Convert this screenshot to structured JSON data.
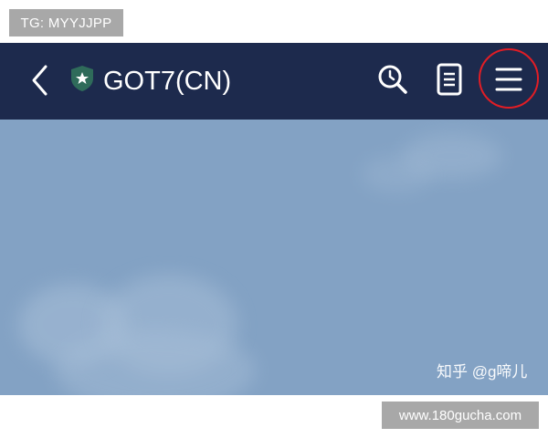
{
  "overlay_tag": "TG: MYYJJPP",
  "header": {
    "title": "GOT7(CN)",
    "icons": [
      "back-arrow-icon",
      "shield-star-icon",
      "search-icon",
      "notes-icon",
      "hamburger-menu-icon"
    ],
    "background": "#1d2a4d",
    "highlight_color": "#e11d25"
  },
  "content": {
    "background": "#83a2c4",
    "watermark": "知乎 @g啼儿"
  },
  "footer_url": "www.180gucha.com"
}
